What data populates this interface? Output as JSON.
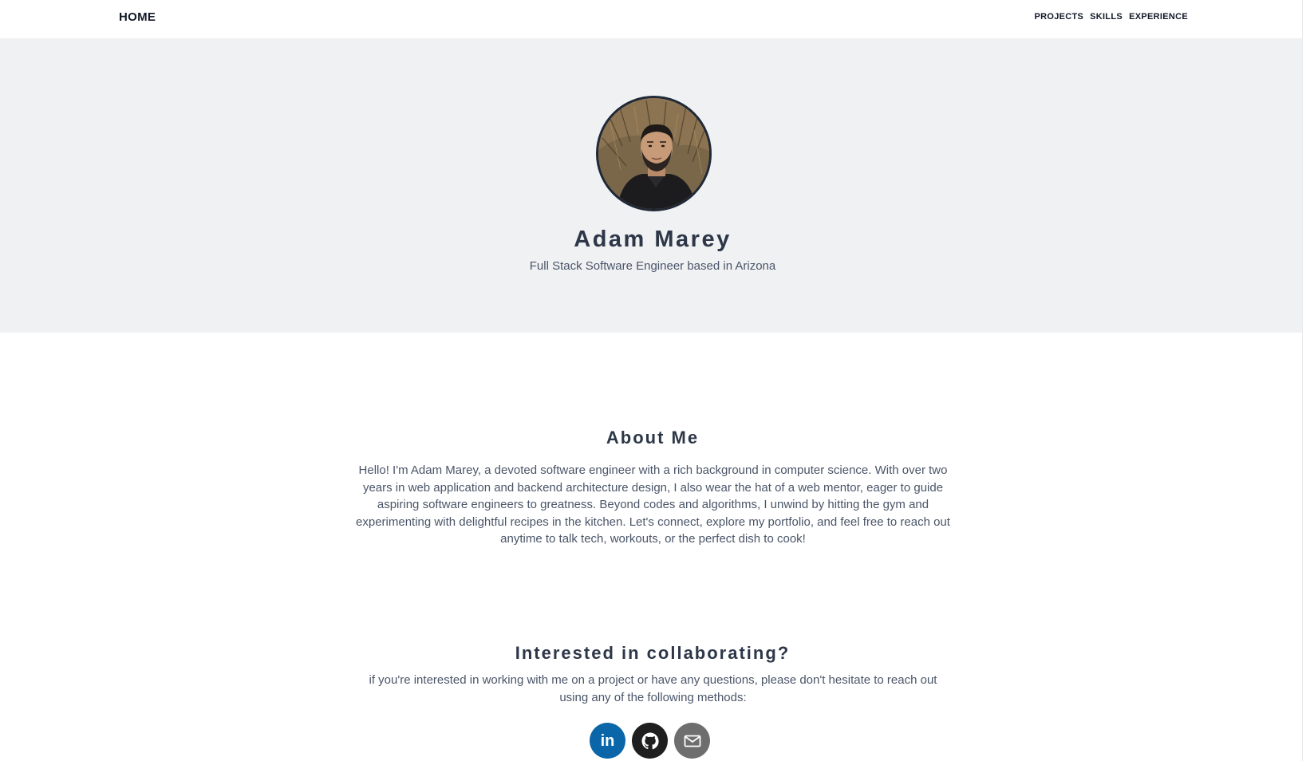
{
  "nav": {
    "home_label": "HOME",
    "links": [
      {
        "label": "PROJECTS"
      },
      {
        "label": "SKILLS"
      },
      {
        "label": "EXPERIENCE"
      }
    ]
  },
  "hero": {
    "name": "Adam Marey",
    "subtitle": "Full Stack Software Engineer based in Arizona",
    "avatar_icon": "profile-photo"
  },
  "about": {
    "title": "About Me",
    "text": "Hello! I'm Adam Marey, a devoted software engineer with a rich background in computer science. With over two years in web application and backend architecture design, I also wear the hat of a web mentor, eager to guide aspiring software engineers to greatness. Beyond codes and algorithms, I unwind by hitting the gym and experimenting with delightful recipes in the kitchen. Let's connect, explore my portfolio, and feel free to reach out anytime to talk tech, workouts, or the perfect dish to cook!"
  },
  "collaborate": {
    "title": "Interested in collaborating?",
    "text": "if you're interested in working with me on a project or have any questions, please don't hesitate to reach out using any of the following methods:"
  },
  "socials": {
    "linkedin": {
      "icon": "linkedin-icon",
      "glyph": "in",
      "color": "#0a66a8"
    },
    "github": {
      "icon": "github-icon",
      "color": "#1f1f1f"
    },
    "email": {
      "icon": "mail-icon",
      "color": "#6e6e6e"
    }
  },
  "colors": {
    "hero_bg": "#f0f1f3",
    "heading": "#2d3748",
    "body_text": "#4a5568"
  }
}
